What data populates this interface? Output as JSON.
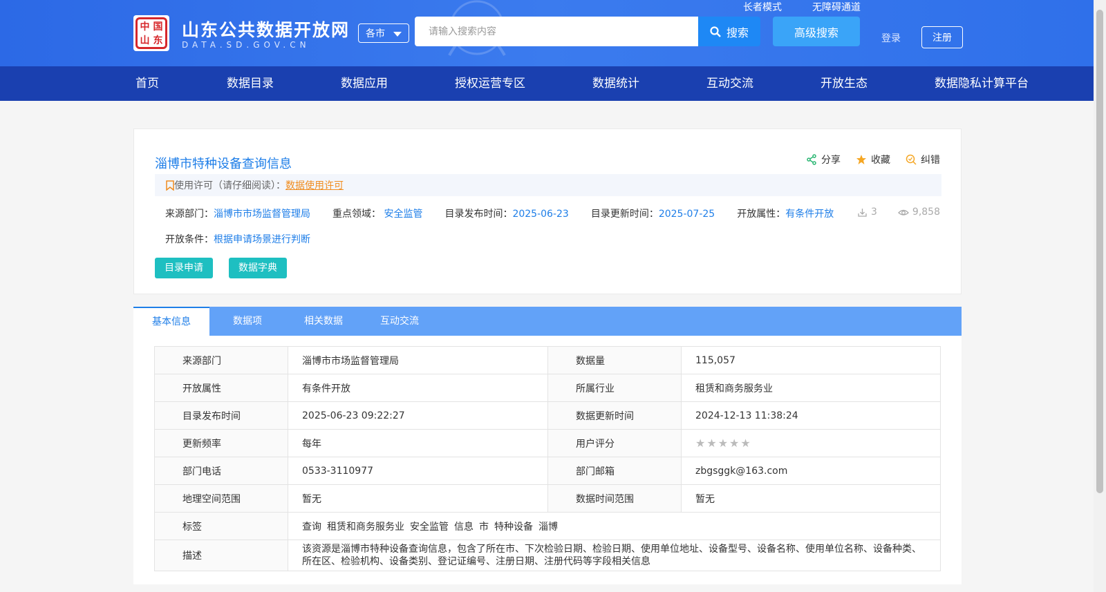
{
  "header": {
    "site_title": "山东公共数据开放网",
    "site_subtitle": "DATA.SD.GOV.CN",
    "logo_glyphs": [
      "中",
      "国",
      "山",
      "东"
    ],
    "city_select": "各市",
    "search_placeholder": "请输入搜索内容",
    "search_button": "搜索",
    "advanced_search": "高级搜索",
    "elder_mode": "长者模式",
    "accessibility": "无障碍通道",
    "login": "登录",
    "register": "注册"
  },
  "nav": [
    "首页",
    "数据目录",
    "数据应用",
    "授权运营专区",
    "数据统计",
    "互动交流",
    "开放生态",
    "数据隐私计算平台"
  ],
  "dataset": {
    "title": "淄博市特种设备查询信息",
    "actions": {
      "share": "分享",
      "favorite": "收藏",
      "correct": "纠错"
    },
    "license_label": "使用许可（请仔细阅读）：",
    "license_link": "数据使用许可",
    "meta": {
      "source_label": "来源部门：",
      "source": "淄博市市场监督管理局",
      "domain_label": "重点领域：",
      "domain": "安全监管",
      "publish_label": "目录发布时间：",
      "publish": "2025-06-23",
      "update_label": "目录更新时间：",
      "update": "2025-07-25",
      "open_label": "开放属性：",
      "open": "有条件开放"
    },
    "downloads": "3",
    "views": "9,858",
    "condition_label": "开放条件：",
    "condition": "根据申请场景进行判断",
    "apply_button": "目录申请",
    "dictionary_button": "数据字典"
  },
  "tabs": [
    "基本信息",
    "数据项",
    "相关数据",
    "互动交流"
  ],
  "info": {
    "rows": [
      {
        "k1": "来源部门",
        "v1": "淄博市市场监督管理局",
        "k2": "数据量",
        "v2": "115,057"
      },
      {
        "k1": "开放属性",
        "v1": "有条件开放",
        "k2": "所属行业",
        "v2": "租赁和商务服务业"
      },
      {
        "k1": "目录发布时间",
        "v1": "2025-06-23 09:22:27",
        "k2": "数据更新时间",
        "v2": "2024-12-13 11:38:24"
      },
      {
        "k1": "更新频率",
        "v1": "每年",
        "k2": "用户评分",
        "v2": ""
      },
      {
        "k1": "部门电话",
        "v1": "0533-3110977",
        "k2": "部门邮箱",
        "v2": "zbgsggk@163.com"
      },
      {
        "k1": "地理空间范围",
        "v1": "暂无",
        "k2": "数据时间范围",
        "v2": "暂无"
      }
    ],
    "rating": 0,
    "tags_label": "标签",
    "tags": [
      "查询",
      "租赁和商务服务业",
      "安全监管",
      "信息",
      "市",
      "特种设备",
      "淄博"
    ],
    "desc_label": "描述",
    "desc": "该资源是淄博市特种设备查询信息，包含了所在市、下次检验日期、检验日期、使用单位地址、设备型号、设备名称、使用单位名称、设备种类、所在区、检验机构、设备类别、登记证编号、注册日期、注册代码等字段相关信息"
  },
  "colors": {
    "header": "#2c69e6",
    "nav": "#1a40b0",
    "accent": "#1e7ee8",
    "teal": "#1ebfc1",
    "tabs": "#62a2f8",
    "license_link": "#f08c1e"
  }
}
